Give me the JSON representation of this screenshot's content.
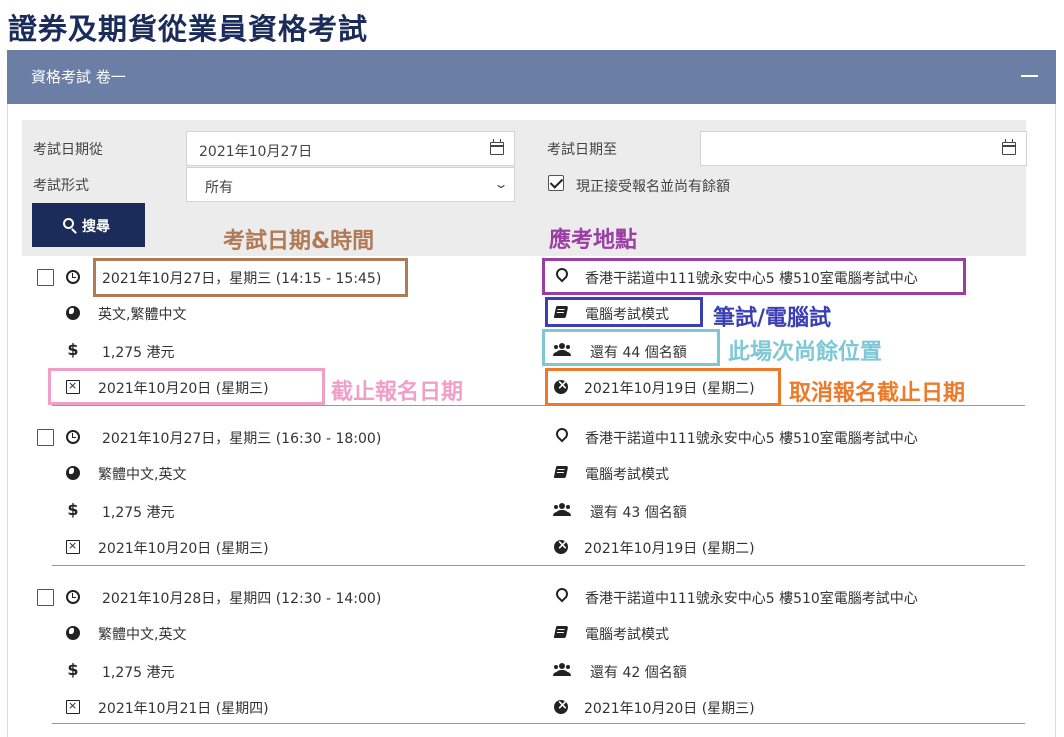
{
  "page_title": "證券及期貨從業員資格考試",
  "panel": {
    "title": "資格考試 卷一"
  },
  "filter": {
    "date_from_label": "考試日期從",
    "date_from_value": "2021年10月27日",
    "date_to_label": "考試日期至",
    "date_to_value": "",
    "format_label": "考試形式",
    "format_value": "所有",
    "available_only_label": "現正接受報名並尚有餘額",
    "available_only_checked": true,
    "search_label": "搜尋"
  },
  "annotations": {
    "datetime": {
      "text": "考試日期&時間",
      "color": "#b07a55"
    },
    "venue": {
      "text": "應考地點",
      "color": "#9b3ea4"
    },
    "mode": {
      "text": "筆試/電腦試",
      "color": "#3b3fb5"
    },
    "seats": {
      "text": "此場次尚餘位置",
      "color": "#7ec8d6"
    },
    "reg_deadline": {
      "text": "截止報名日期",
      "color": "#f0a0c8"
    },
    "cancel_deadline": {
      "text": "取消報名截止日期",
      "color": "#ec7a2a"
    }
  },
  "sessions": [
    {
      "datetime": "2021年10月27日，星期三 (14:15 - 15:45)",
      "languages": "英文,繁體中文",
      "fee": "1,275 港元",
      "reg_deadline": "2021年10月20日 (星期三)",
      "venue": "香港干諾道中111號永安中心5 樓510室電腦考試中心",
      "mode": "電腦考試模式",
      "seats": "還有 44 個名額",
      "cancel_deadline": "2021年10月19日 (星期二)"
    },
    {
      "datetime": "2021年10月27日，星期三 (16:30 - 18:00)",
      "languages": "繁體中文,英文",
      "fee": "1,275 港元",
      "reg_deadline": "2021年10月20日 (星期三)",
      "venue": "香港干諾道中111號永安中心5 樓510室電腦考試中心",
      "mode": "電腦考試模式",
      "seats": "還有 43 個名額",
      "cancel_deadline": "2021年10月19日 (星期二)"
    },
    {
      "datetime": "2021年10月28日，星期四 (12:30 - 14:00)",
      "languages": "繁體中文,英文",
      "fee": "1,275 港元",
      "reg_deadline": "2021年10月21日 (星期四)",
      "venue": "香港干諾道中111號永安中心5 樓510室電腦考試中心",
      "mode": "電腦考試模式",
      "seats": "還有 42 個名額",
      "cancel_deadline": "2021年10月20日 (星期三)"
    }
  ]
}
